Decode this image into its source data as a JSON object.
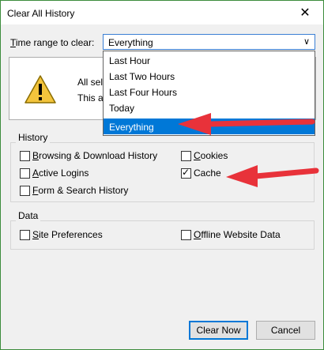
{
  "window": {
    "title": "Clear All History",
    "close_glyph": "✕"
  },
  "time_range": {
    "label_prefix": "",
    "label_accel": "T",
    "label_rest": "ime range to clear:",
    "selected": "Everything",
    "chevron": "∨",
    "options": [
      "Last Hour",
      "Last Two Hours",
      "Last Four Hours",
      "Today",
      "Everything"
    ]
  },
  "warning": {
    "icon": "warning-triangle-icon",
    "line1": "All sele",
    "line2": "This ac"
  },
  "history": {
    "legend": "History",
    "items": [
      {
        "accel": "B",
        "rest": "rowsing & Download History",
        "checked": false
      },
      {
        "accel": "C",
        "rest": "ookies",
        "checked": false
      },
      {
        "accel": "A",
        "rest": "ctive Logins",
        "checked": false
      },
      {
        "accel": "",
        "rest": "Cache",
        "checked": true
      },
      {
        "accel": "F",
        "rest": "orm & Search History",
        "checked": false
      }
    ]
  },
  "data_group": {
    "legend": "Data",
    "items": [
      {
        "accel": "S",
        "rest": "ite Preferences",
        "checked": false
      },
      {
        "accel": "O",
        "rest": "ffline Website Data",
        "checked": false
      }
    ]
  },
  "buttons": {
    "clear_now": "Clear Now",
    "cancel": "Cancel"
  },
  "colors": {
    "accent": "#0078d7",
    "arrow": "#e8323a",
    "window_border": "#3c8c3c"
  }
}
